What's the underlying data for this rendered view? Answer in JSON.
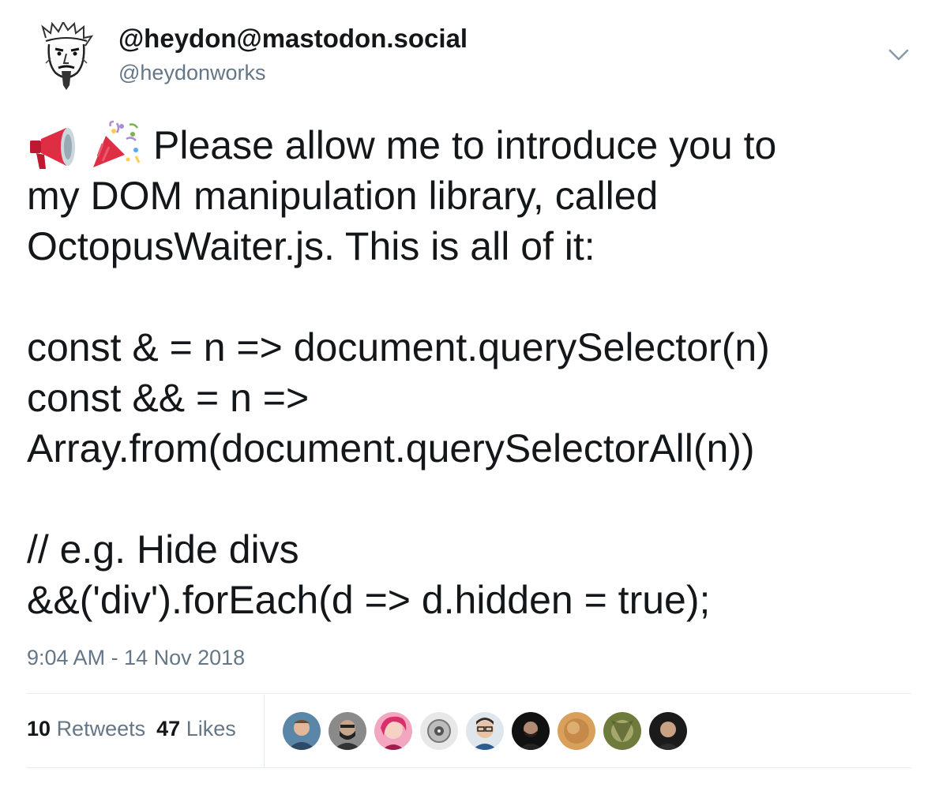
{
  "header": {
    "display_name": "@heydon@mastodon.social",
    "handle": "@heydonworks",
    "avatar_icon": "sketch-portrait-icon",
    "menu_icon": "chevron-down-icon"
  },
  "tweet": {
    "emojis": [
      "megaphone-emoji-icon",
      "party-popper-emoji-icon"
    ],
    "lines": [
      "Please allow me to introduce you to",
      "my DOM manipulation library, called",
      "OctopusWaiter.js. This is all of it:",
      "",
      "const & = n => document.querySelector(n)",
      "const && = n =>",
      "Array.from(document.querySelectorAll(n))",
      "",
      "// e.g. Hide divs",
      "&&('div').forEach(d => d.hidden = true);"
    ],
    "timestamp": "9:04 AM - 14 Nov 2018"
  },
  "stats": {
    "retweets_count": "10",
    "retweets_label": "Retweets",
    "likes_count": "47",
    "likes_label": "Likes"
  },
  "colors": {
    "text": "#14171a",
    "secondary": "#657786",
    "divider": "#e6ecf0"
  }
}
